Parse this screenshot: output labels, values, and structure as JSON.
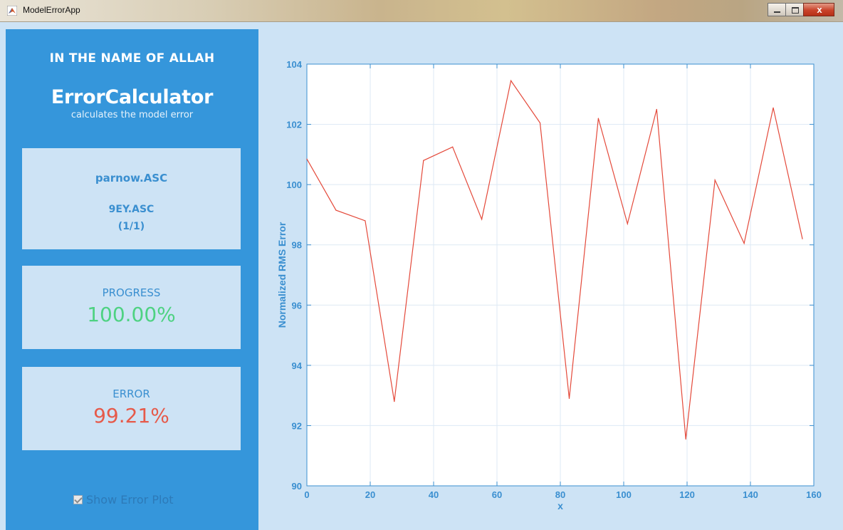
{
  "window": {
    "title": "ModelErrorApp",
    "close_glyph": "x"
  },
  "panel": {
    "dedication": "IN THE NAME OF ALLAH",
    "app_name": "ErrorCalculator",
    "subtitle": "calculates the model error",
    "file_primary": "parnow.ASC",
    "file_secondary": "9EY.ASC",
    "file_count": "(1/1)",
    "progress_label": "PROGRESS",
    "progress_value": "100.00%",
    "progress_fraction": 1.0,
    "error_label": "ERROR",
    "error_value": "99.21%",
    "show_plot_label": "Show Error Plot",
    "show_plot_checked": true
  },
  "colors": {
    "panel_blue": "#3596db",
    "card_bg": "#cde3f5",
    "text_blue": "#3a8fd0",
    "progress_green": "#4ed282",
    "error_red": "#e65a4a",
    "line_color": "#e4493a"
  },
  "chart_data": {
    "type": "line",
    "xlabel": "x",
    "ylabel": "Normalized RMS Error",
    "xlim": [
      0,
      160
    ],
    "ylim": [
      90,
      104
    ],
    "xticks": [
      0,
      20,
      40,
      60,
      80,
      100,
      120,
      140,
      160
    ],
    "yticks": [
      90,
      92,
      94,
      96,
      98,
      100,
      102,
      104
    ],
    "grid": true,
    "series": [
      {
        "x": [
          0,
          9.2,
          18.4,
          27.6,
          36.8,
          46,
          55.2,
          64.4,
          73.6,
          82.8,
          92,
          101.2,
          110.4,
          119.6,
          128.8,
          138,
          147.2,
          156.4
        ],
        "y": [
          100.85,
          99.15,
          98.8,
          92.8,
          100.8,
          101.25,
          98.85,
          103.45,
          102.05,
          92.9,
          102.2,
          98.7,
          102.5,
          91.55,
          100.15,
          98.05,
          102.55,
          98.2
        ]
      }
    ]
  }
}
